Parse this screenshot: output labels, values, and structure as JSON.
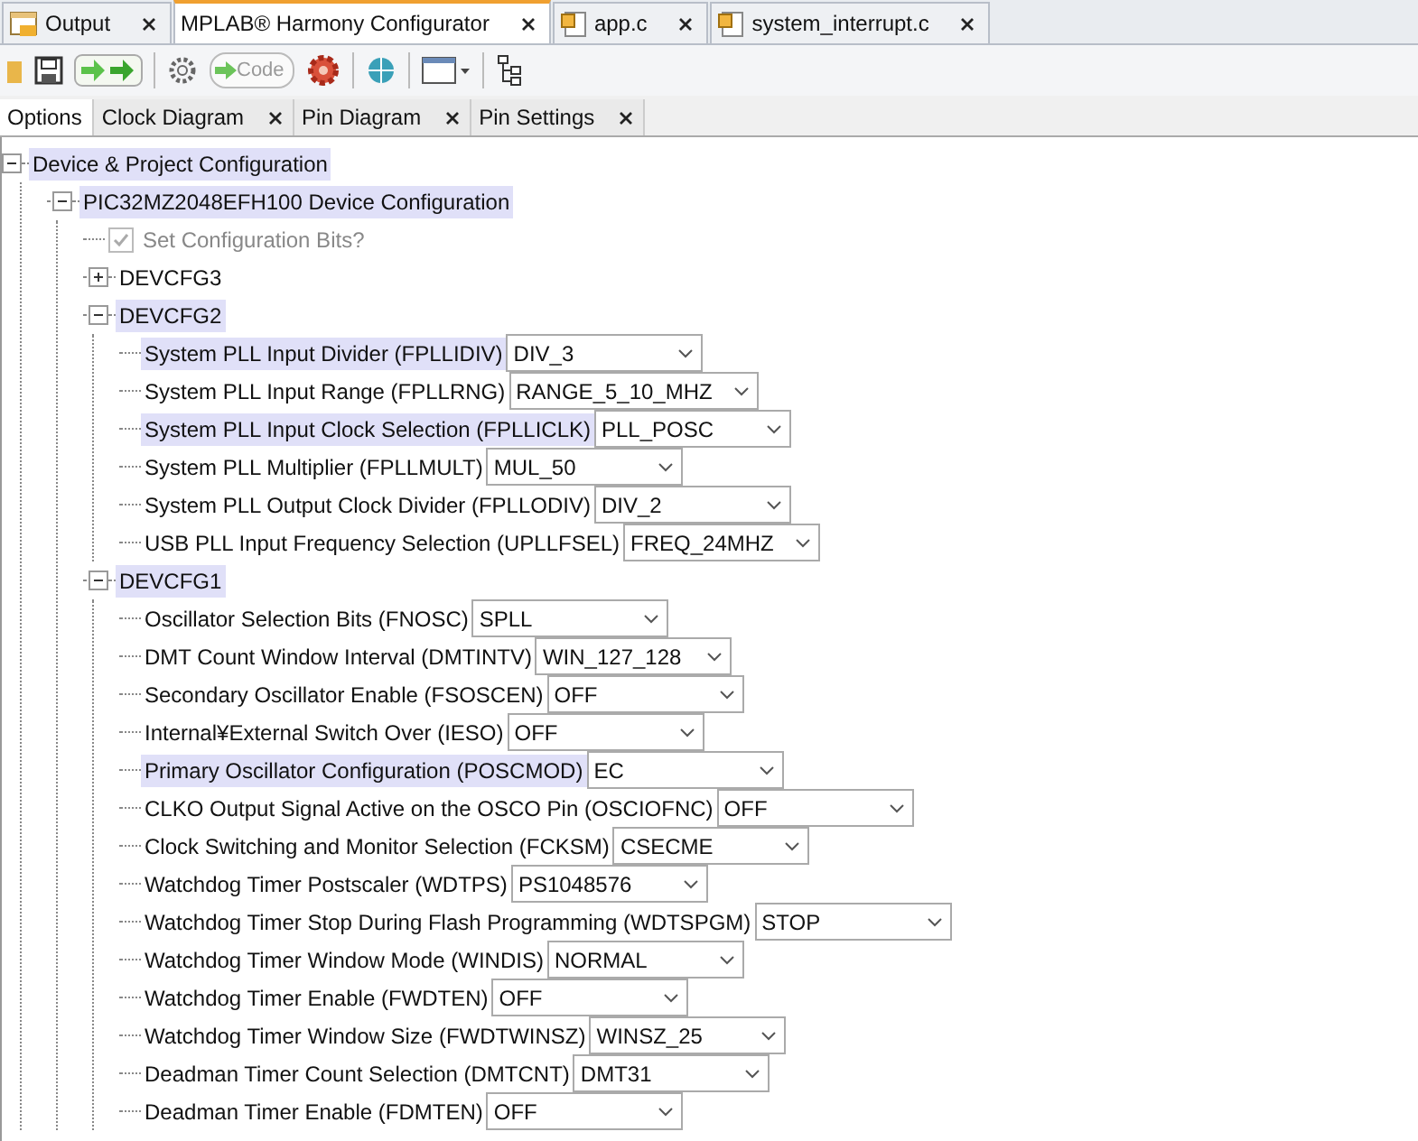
{
  "editor_tabs": [
    {
      "label": "Output",
      "kind": "output",
      "selected": false
    },
    {
      "label": "MPLAB® Harmony Configurator",
      "kind": "plain",
      "selected": true
    },
    {
      "label": "app.c",
      "kind": "file",
      "selected": false
    },
    {
      "label": "system_interrupt.c",
      "kind": "file",
      "selected": false
    }
  ],
  "toolbar": {
    "generate_label": "Code"
  },
  "sub_tabs": [
    {
      "label": "Options",
      "closable": false,
      "selected": true
    },
    {
      "label": "Clock Diagram",
      "closable": true,
      "selected": false
    },
    {
      "label": "Pin Diagram",
      "closable": true,
      "selected": false
    },
    {
      "label": "Pin Settings",
      "closable": true,
      "selected": false
    }
  ],
  "tree": [
    {
      "kind": "group",
      "label": "Device & Project Configuration",
      "expanded": true,
      "highlighted": true,
      "children": [
        {
          "kind": "group",
          "label": "PIC32MZ2048EFH100 Device Configuration",
          "expanded": true,
          "highlighted": true,
          "children": [
            {
              "kind": "checkbox",
              "label": "Set Configuration Bits?",
              "checked": true,
              "disabled": true
            },
            {
              "kind": "group",
              "label": "DEVCFG3",
              "expanded": false,
              "highlighted": false
            },
            {
              "kind": "group",
              "label": "DEVCFG2",
              "expanded": true,
              "highlighted": true,
              "children": [
                {
                  "kind": "combo",
                  "label": "System PLL Input Divider (FPLLIDIV)",
                  "value": "DIV_3",
                  "highlighted": true
                },
                {
                  "kind": "combo",
                  "label": "System PLL Input Range (FPLLRNG)",
                  "value": "RANGE_5_10_MHZ",
                  "highlighted": false
                },
                {
                  "kind": "combo",
                  "label": "System PLL Input Clock Selection (FPLLICLK)",
                  "value": "PLL_POSC",
                  "highlighted": true
                },
                {
                  "kind": "combo",
                  "label": "System PLL Multiplier (FPLLMULT)",
                  "value": "MUL_50",
                  "highlighted": false
                },
                {
                  "kind": "combo",
                  "label": "System PLL Output Clock Divider (FPLLODIV)",
                  "value": "DIV_2",
                  "highlighted": false
                },
                {
                  "kind": "combo",
                  "label": "USB PLL Input Frequency Selection (UPLLFSEL)",
                  "value": "FREQ_24MHZ",
                  "highlighted": false
                }
              ]
            },
            {
              "kind": "group",
              "label": "DEVCFG1",
              "expanded": true,
              "highlighted": true,
              "children": [
                {
                  "kind": "combo",
                  "label": "Oscillator Selection Bits (FNOSC)",
                  "value": "SPLL",
                  "highlighted": false
                },
                {
                  "kind": "combo",
                  "label": "DMT Count Window Interval (DMTINTV)",
                  "value": "WIN_127_128",
                  "highlighted": false
                },
                {
                  "kind": "combo",
                  "label": "Secondary Oscillator Enable (FSOSCEN)",
                  "value": "OFF",
                  "highlighted": false
                },
                {
                  "kind": "combo",
                  "label": "Internal¥External Switch Over (IESO)",
                  "value": "OFF",
                  "highlighted": false
                },
                {
                  "kind": "combo",
                  "label": "Primary Oscillator Configuration (POSCMOD)",
                  "value": "EC",
                  "highlighted": true
                },
                {
                  "kind": "combo",
                  "label": "CLKO Output Signal Active on the OSCO Pin (OSCIOFNC)",
                  "value": "OFF",
                  "highlighted": false
                },
                {
                  "kind": "combo",
                  "label": "Clock Switching and Monitor Selection (FCKSM)",
                  "value": "CSECME",
                  "highlighted": false
                },
                {
                  "kind": "combo",
                  "label": "Watchdog Timer Postscaler (WDTPS)",
                  "value": "PS1048576",
                  "highlighted": false
                },
                {
                  "kind": "combo",
                  "label": "Watchdog Timer Stop During Flash Programming (WDTSPGM)",
                  "value": "STOP",
                  "highlighted": false
                },
                {
                  "kind": "combo",
                  "label": "Watchdog Timer Window Mode (WINDIS)",
                  "value": "NORMAL",
                  "highlighted": false
                },
                {
                  "kind": "combo",
                  "label": "Watchdog Timer Enable (FWDTEN)",
                  "value": "OFF",
                  "highlighted": false
                },
                {
                  "kind": "combo",
                  "label": "Watchdog Timer Window Size (FWDTWINSZ)",
                  "value": "WINSZ_25",
                  "highlighted": false
                },
                {
                  "kind": "combo",
                  "label": "Deadman Timer Count Selection (DMTCNT)",
                  "value": "DMT31",
                  "highlighted": false
                },
                {
                  "kind": "combo",
                  "label": "Deadman Timer Enable (FDMTEN)",
                  "value": "OFF",
                  "highlighted": false
                }
              ]
            }
          ]
        }
      ]
    }
  ]
}
